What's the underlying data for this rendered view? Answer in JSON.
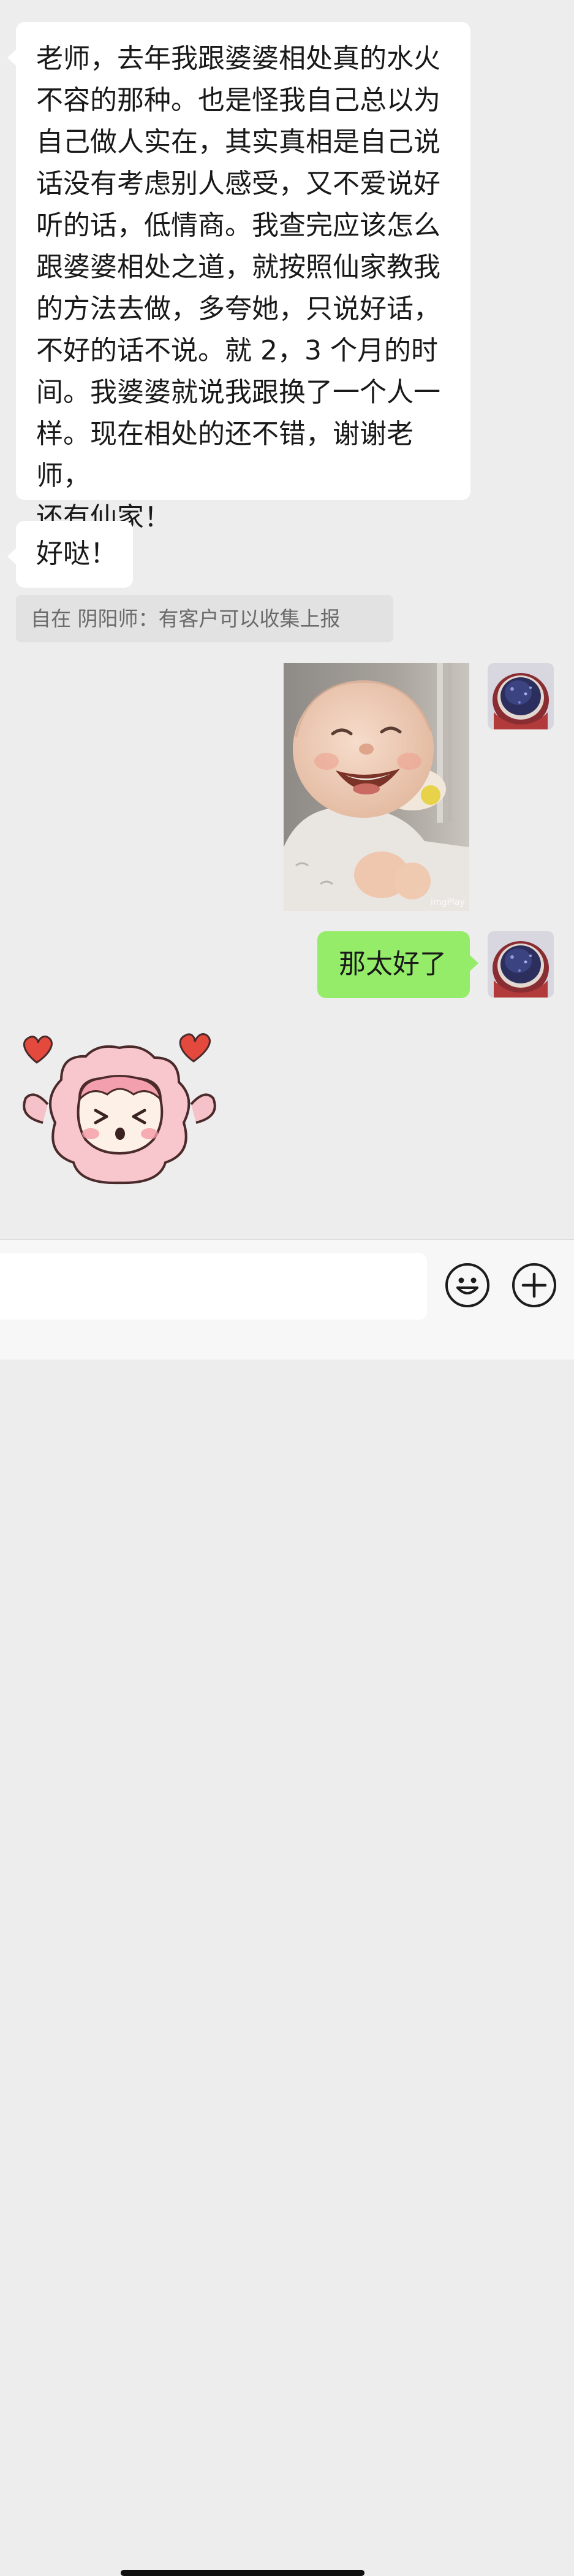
{
  "messages": [
    {
      "side": "left",
      "lines": [
        "老师，去年我跟婆婆相处真的水火",
        "不容的那种。也是怪我自己总以为",
        "自己做人实在，其实真相是自己说",
        "话没有考虑别人感受，又不爱说好",
        "听的话，低情商。我查完应该怎么",
        "跟婆婆相处之道，就按照仙家教我",
        "的方法去做，多夸她，只说好话，",
        "不好的话不说。就 2，3 个月的时",
        "间。我婆婆就说我跟换了一个人一",
        "样。现在相处的还不错，谢谢老师，",
        "还有仙家！"
      ]
    },
    {
      "side": "left",
      "text": "好哒！"
    },
    {
      "quote": "自在 阴阳师：有客户可以收集上报"
    },
    {
      "side": "right",
      "image": "laughing-baby-photo",
      "watermark": "imgPlay"
    },
    {
      "side": "right",
      "text": "那太好了"
    },
    {
      "side": "left",
      "sticker": "pink-sheep-hearts-sticker"
    }
  ],
  "avatar": {
    "icon": "geode-avatar"
  },
  "input_bar": {
    "input_value": "",
    "emoji_icon": "emoji-icon",
    "plus_icon": "plus-icon"
  },
  "colors": {
    "background": "#ededed",
    "incoming_bubble": "#ffffff",
    "outgoing_bubble": "#95ec69",
    "quote_bg": "#e2e2e2"
  }
}
